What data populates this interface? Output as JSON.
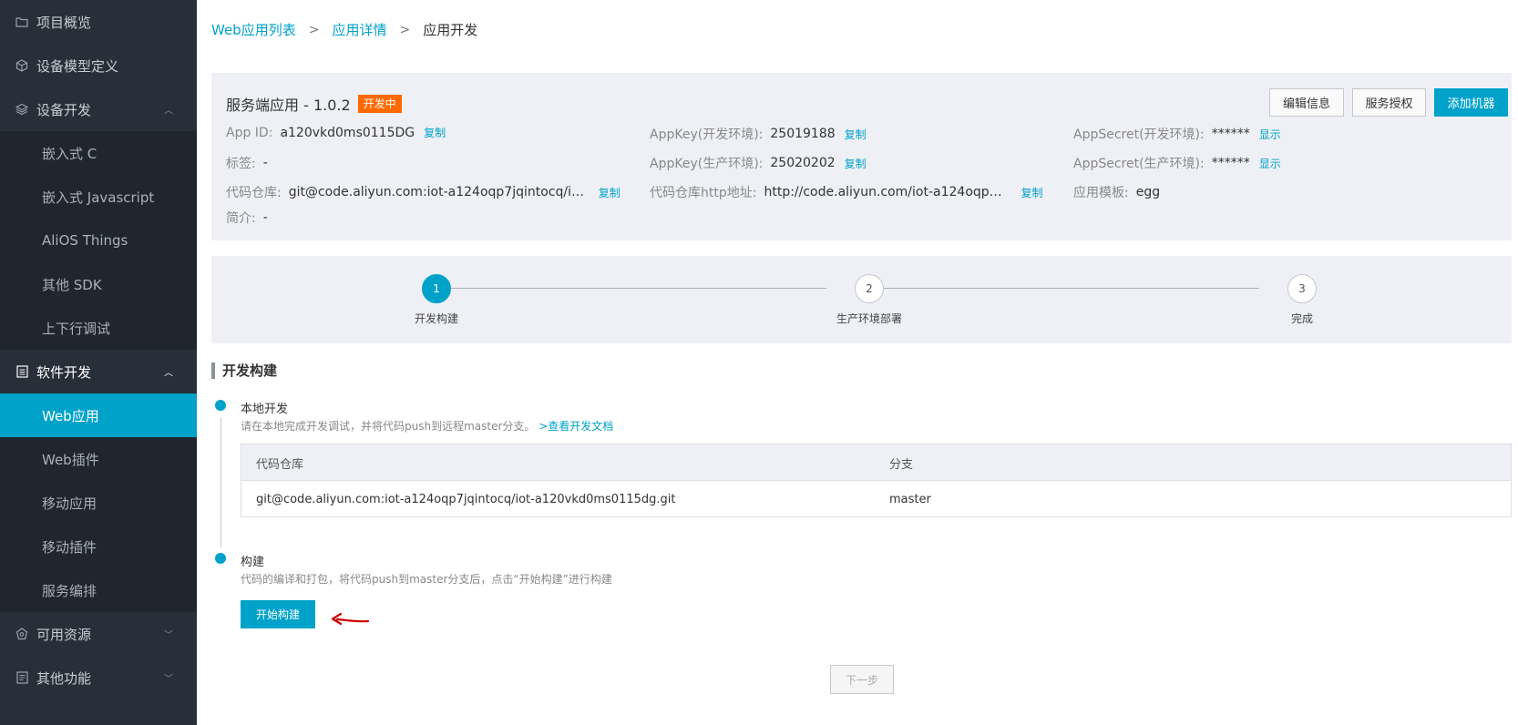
{
  "sidebar": {
    "items": [
      {
        "label": "项目概览",
        "icon": "folder-icon"
      },
      {
        "label": "设备模型定义",
        "icon": "cube-icon"
      },
      {
        "label": "设备开发",
        "icon": "layers-icon",
        "expanded": true
      },
      {
        "label": "嵌入式 C"
      },
      {
        "label": "嵌入式 Javascript"
      },
      {
        "label": "AliOS Things"
      },
      {
        "label": "其他 SDK"
      },
      {
        "label": "上下行调试"
      },
      {
        "label": "软件开发",
        "icon": "document-icon",
        "expanded": true
      },
      {
        "label": "Web应用",
        "active": true
      },
      {
        "label": "Web插件"
      },
      {
        "label": "移动应用"
      },
      {
        "label": "移动插件"
      },
      {
        "label": "服务编排"
      },
      {
        "label": "可用资源",
        "icon": "resource-icon",
        "expanded": false
      },
      {
        "label": "其他功能",
        "icon": "list-icon",
        "expanded": false
      }
    ]
  },
  "breadcrumb": {
    "items": [
      "Web应用列表",
      "应用详情",
      "应用开发"
    ],
    "separator": ">"
  },
  "app": {
    "title": "服务端应用 - 1.0.2",
    "status": "开发中",
    "buttons": {
      "edit": "编辑信息",
      "auth": "服务授权",
      "add_machine": "添加机器"
    },
    "fields": {
      "app_id": {
        "label": "App ID:",
        "value": "a120vkd0ms0115DG",
        "action": "复制"
      },
      "appkey_dev": {
        "label": "AppKey(开发环境):",
        "value": "25019188",
        "action": "复制"
      },
      "appsecret_dev": {
        "label": "AppSecret(开发环境):",
        "value": "******",
        "action": "显示"
      },
      "tags": {
        "label": "标签:",
        "value": "-"
      },
      "appkey_prod": {
        "label": "AppKey(生产环境):",
        "value": "25020202",
        "action": "复制"
      },
      "appsecret_prod": {
        "label": "AppSecret(生产环境):",
        "value": "******",
        "action": "显示"
      },
      "repo": {
        "label": "代码仓库:",
        "value": "git@code.aliyun.com:iot-a124oqp7jqintocq/iot-a1...",
        "action": "复制"
      },
      "repo_http": {
        "label": "代码仓库http地址:",
        "value": "http://code.aliyun.com/iot-a124oqp7jqint...",
        "action": "复制"
      },
      "template": {
        "label": "应用模板:",
        "value": "egg"
      },
      "intro": {
        "label": "简介:",
        "value": "-"
      }
    }
  },
  "steps": [
    {
      "num": "1",
      "label": "开发构建",
      "active": true
    },
    {
      "num": "2",
      "label": "生产环境部署",
      "active": false
    },
    {
      "num": "3",
      "label": "完成",
      "active": false
    }
  ],
  "section_title": "开发构建",
  "timeline": {
    "local": {
      "title": "本地开发",
      "desc": "请在本地完成开发调试，并将代码push到远程master分支。",
      "link": ">查看开发文档"
    },
    "table": {
      "headers": [
        "代码仓库",
        "分支"
      ],
      "rows": [
        [
          "git@code.aliyun.com:iot-a124oqp7jqintocq/iot-a120vkd0ms0115dg.git",
          "master"
        ]
      ]
    },
    "build": {
      "title": "构建",
      "desc": "代码的编译和打包，将代码push到master分支后，点击“开始构建”进行构建",
      "button": "开始构建"
    }
  },
  "next_button": "下一步",
  "colors": {
    "accent": "#00a2ca",
    "sidebar_bg": "#273039",
    "badge": "#ff6a00",
    "annotation_arrow": "#cc0000"
  }
}
